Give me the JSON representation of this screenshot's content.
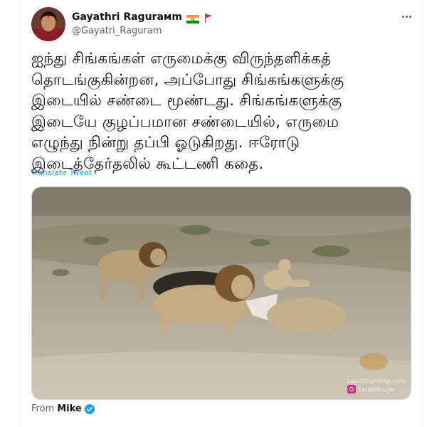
{
  "user": {
    "display_name": "Gayathri Ragurамm",
    "handle": "@Gayatri_Raguram",
    "avatar_icon": "profile-photo",
    "flags": [
      "india-flag-icon",
      "red-flag-icon"
    ]
  },
  "tweet": {
    "text": "ஐந்து சிங்கங்கள் எருமைக்கு விருந்தளிக்கத்\nதொடங்குகின்றன, அப்போது சிங்கங்களுக்கு\nஇடையில் சண்டை மூண்டது. சிங்கங்களுக்கு\nஇடையே குழப்பமான சண்டையில், எருமை\nஎழுந்து நின்று தப்பி ஓடுகிறது. ஈரோடு\nஇடைத்தேர்தலில் கூட்டணி கதை.",
    "translate_label": "Translate Tweet"
  },
  "media": {
    "watermark": "LatestSightings.com",
    "instagram_handle": "LatestKruger"
  },
  "source": {
    "from_label": "From",
    "from_name": "Mike"
  },
  "colors": {
    "link": "#1d9bf0",
    "secondary_text": "#536471",
    "primary_text": "#0f1419"
  }
}
